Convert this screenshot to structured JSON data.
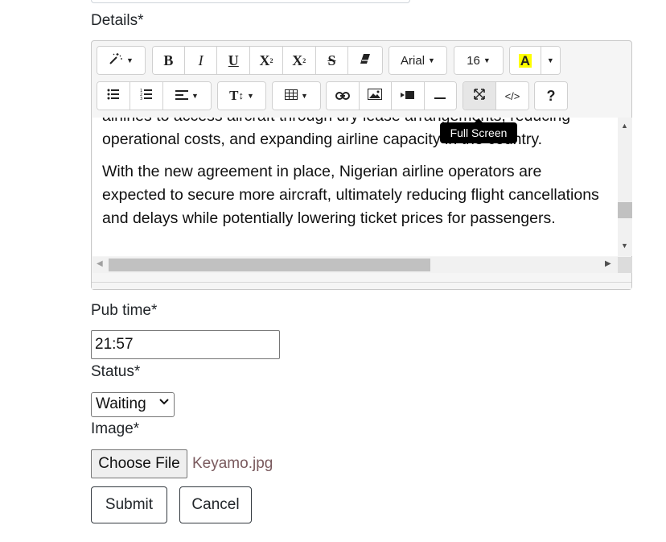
{
  "form": {
    "details_label": "Details*",
    "pubtime_label": "Pub time*",
    "pubtime_value": "21:57",
    "status_label": "Status*",
    "status_value": "Waiting",
    "image_label": "Image*",
    "choose_file_label": "Choose File",
    "file_name": "Keyamo.jpg",
    "submit_label": "Submit",
    "cancel_label": "Cancel"
  },
  "toolbar": {
    "bold": "B",
    "italic": "I",
    "underline": "U",
    "superscript": "X",
    "subscript": "X",
    "strikethrough": "S",
    "font_name": "Arial",
    "font_size": "16",
    "font_color": "A",
    "line_height": "T",
    "help": "?",
    "code_view": "</>"
  },
  "editor": {
    "paragraph1": "airlines to access aircraft through dry lease arrangements, reducing operational costs, and expanding airline capacity in the country.",
    "paragraph2": "With the new agreement in place, Nigerian airline operators are expected to secure more aircraft, ultimately reducing flight cancellations and delays while potentially lowering ticket prices for passengers."
  },
  "tooltip": {
    "text": "Full Screen"
  },
  "colors": {
    "highlight": "#ffff00",
    "tooltip_bg": "#000000",
    "file_name": "#7a5a5e"
  },
  "icons": [
    "magic-icon",
    "unordered-list-icon",
    "ordered-list-icon",
    "align-icon",
    "table-icon",
    "link-icon",
    "picture-icon",
    "video-icon",
    "horizontal-rule-icon",
    "fullscreen-icon",
    "eraser-icon"
  ]
}
